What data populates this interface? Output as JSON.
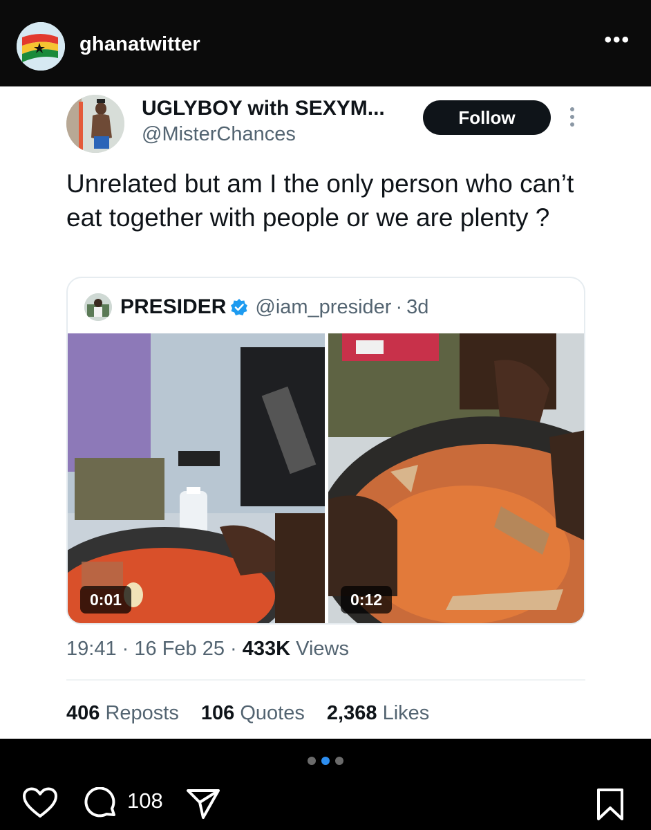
{
  "ig_header": {
    "username": "ghanatwitter",
    "more_label": "•••"
  },
  "tweet": {
    "author_name": "UGLYBOY with SEXYM...",
    "author_handle": "@MisterChances",
    "follow_label": "Follow",
    "text": "Unrelated but am I the only person who can’t eat together with people or we are plenty ?",
    "quoted": {
      "name": "PRESIDER",
      "handle": "@iam_presider",
      "separator": "·",
      "time": "3d",
      "media": [
        {
          "duration": "0:01"
        },
        {
          "duration": "0:12"
        }
      ]
    },
    "meta": {
      "time": "19:41",
      "sep1": "·",
      "date": "16 Feb 25",
      "sep2": "·",
      "views_count": "433K",
      "views_label": "Views"
    },
    "stats": {
      "reposts_count": "406",
      "reposts_label": "Reposts",
      "quotes_count": "106",
      "quotes_label": "Quotes",
      "likes_count": "2,368",
      "likes_label": "Likes"
    }
  },
  "carousel": {
    "total": 3,
    "active_index": 1
  },
  "actions": {
    "comment_count": "108"
  },
  "colors": {
    "verified_badge": "#1d9bf0",
    "follow_button": "#0f1419",
    "active_dot": "#2d8ef0"
  }
}
